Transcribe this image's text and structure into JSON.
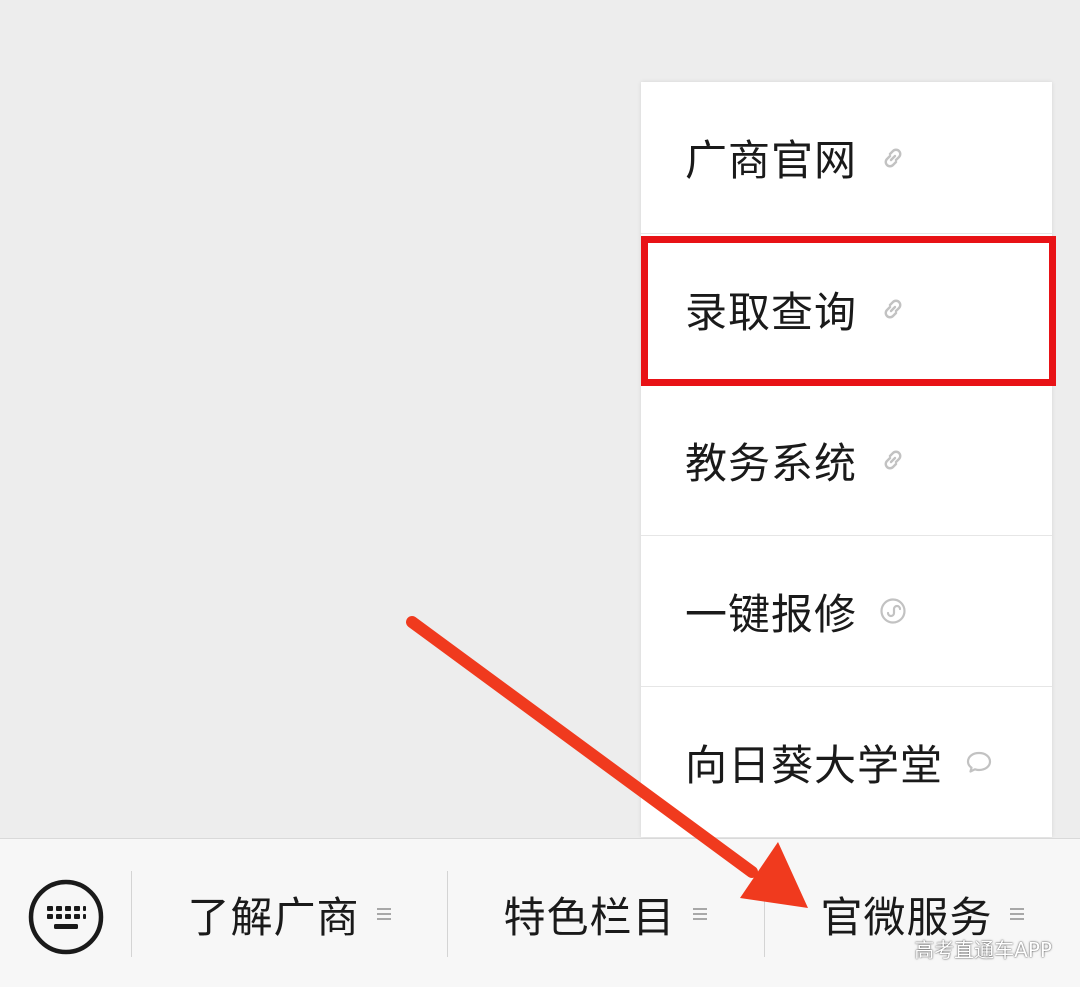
{
  "submenu": {
    "items": [
      {
        "label": "广商官网",
        "icon": "link-icon"
      },
      {
        "label": "录取查询",
        "icon": "link-icon"
      },
      {
        "label": "教务系统",
        "icon": "link-icon"
      },
      {
        "label": "一键报修",
        "icon": "mini-program-icon"
      },
      {
        "label": "向日葵大学堂",
        "icon": "message-bubble-icon"
      }
    ]
  },
  "bottom_bar": {
    "keyboard_icon": "keyboard-icon",
    "tabs": [
      {
        "label": "了解广商",
        "icon": "menu-lines-icon"
      },
      {
        "label": "特色栏目",
        "icon": "menu-lines-icon"
      },
      {
        "label": "官微服务",
        "icon": "menu-lines-icon"
      }
    ]
  },
  "watermark": "高考直通车APP",
  "colors": {
    "highlight": "#e81216",
    "arrow": "#f03a1e",
    "background": "#ededed"
  }
}
